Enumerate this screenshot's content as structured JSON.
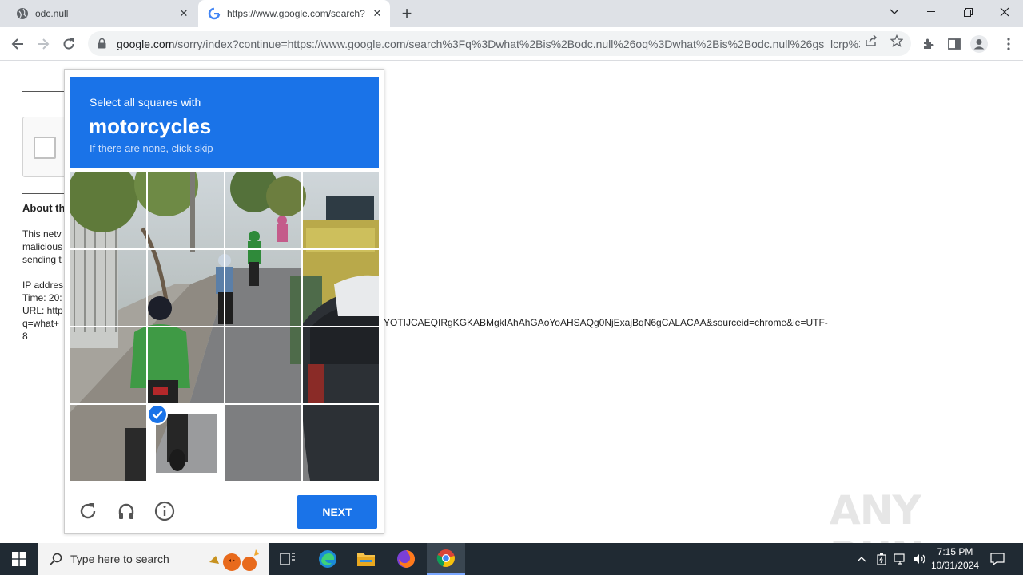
{
  "browser": {
    "tabs": [
      {
        "title": "odc.null",
        "active": false
      },
      {
        "title": "https://www.google.com/search?",
        "active": true
      }
    ],
    "new_tab": "+",
    "window_controls": [
      "chevron-down",
      "minimize",
      "restore",
      "close"
    ],
    "address_bar": {
      "host": "google.com",
      "path": "/sorry/index?continue=https://www.google.com/search%3Fq%3Dwhat%2Bis%2Bodc.null%26oq%3Dwhat%2Bis%2Bodc.null%26gs_lcrp%3D..."
    }
  },
  "page": {
    "about_heading": "About th",
    "para_lines": [
      "This netv",
      "malicious",
      "sending t"
    ],
    "info_lines": [
      "IP addres",
      "Time: 20:",
      "URL: http",
      "q=what+",
      "8"
    ],
    "url_tail": "YOTIJCAEQIRgKGKABMgkIAhAhGAoYoAHSAQg0NjExajBqN6gCALACAA&sourceid=chrome&ie=UTF-"
  },
  "challenge": {
    "instruction": "Select all squares with",
    "target": "motorcycles",
    "hint": "If there are none, click skip",
    "selected_cells": [
      13
    ],
    "next_label": "NEXT",
    "footer_icons": [
      "reload-icon",
      "headphones-icon",
      "info-icon"
    ]
  },
  "watermark": "ANY RUN",
  "taskbar": {
    "search_placeholder": "Type here to search",
    "time": "7:15 PM",
    "date": "10/31/2024"
  }
}
